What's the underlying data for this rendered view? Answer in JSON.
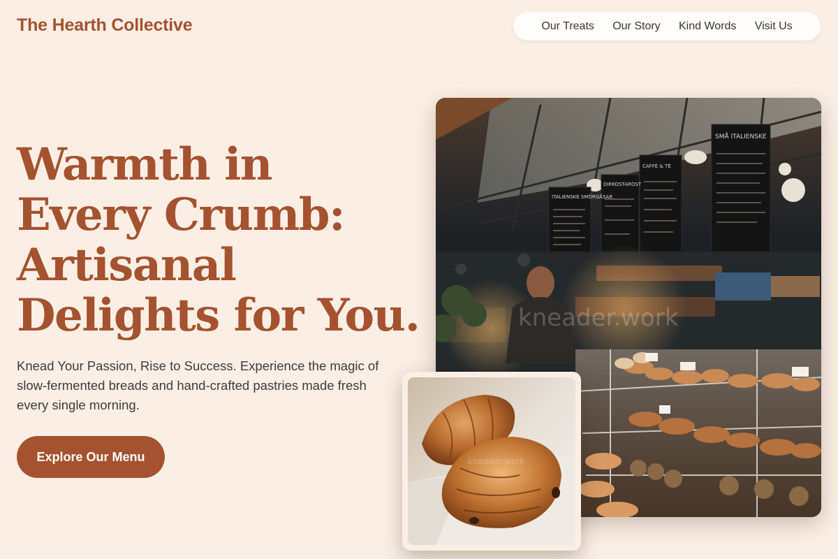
{
  "header": {
    "logo": "The Hearth Collective",
    "nav": [
      {
        "label": "Our Treats"
      },
      {
        "label": "Our Story"
      },
      {
        "label": "Kind Words"
      },
      {
        "label": "Visit Us"
      }
    ]
  },
  "hero": {
    "headline_lines": [
      "Warmth in",
      "Every Crumb:",
      "Artisanal",
      "Delights for You."
    ],
    "subtext": "Knead Your Passion, Rise to Success. Experience the magic of slow-fermented breads and hand-crafted pastries made fresh every single morning.",
    "cta_label": "Explore Our Menu"
  },
  "images": {
    "main_watermark": "kneader.work",
    "pastry_watermark": "kneader.work",
    "boards": [
      {
        "title": "ITALIENSKE SMÖRGÅSAR"
      },
      {
        "title": "DIRKOSTAROST"
      },
      {
        "title": "CAFFÈ & TÈ"
      },
      {
        "title": "SMÅ ITALIENSKE"
      }
    ]
  },
  "colors": {
    "background": "#fbefe5",
    "accent": "#a4522f",
    "nav_bg": "#fffdfb",
    "text": "#3d3a3d"
  }
}
